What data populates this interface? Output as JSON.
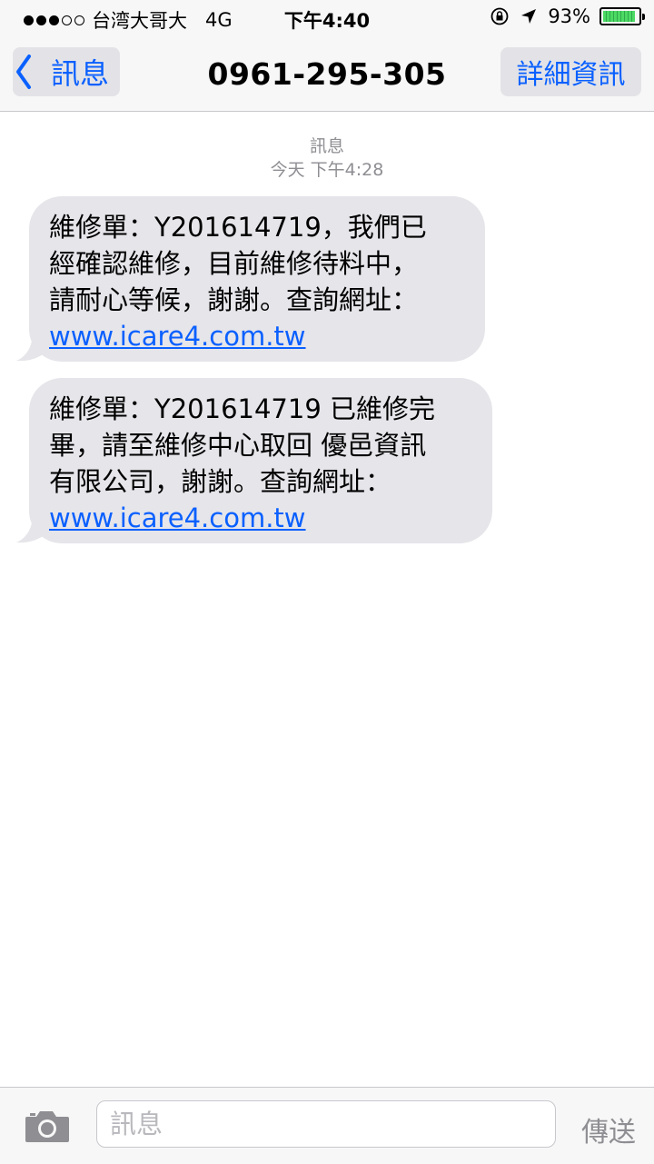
{
  "status_bar": {
    "carrier": "台湾大哥大",
    "network": "4G",
    "time": "下午4:40",
    "battery_percent_label": "93%",
    "battery_level": 0.93,
    "signal_bars_filled": 3,
    "signal_bars_total": 5
  },
  "nav": {
    "back_label": "訊息",
    "title": "0961-295-305",
    "details_label": "詳細資訊"
  },
  "conversation": {
    "service_label": "訊息",
    "timestamp": "今天 下午4:28"
  },
  "messages": [
    {
      "lines": [
        "維修單：Y201614719，我們已",
        "經確認維修，目前維修待料中，",
        "請耐心等候，謝謝。查詢網址："
      ],
      "link": "www.icare4.com.tw"
    },
    {
      "lines": [
        "維修單：Y201614719 已維修完",
        "畢，請至維修中心取回 優邑資訊",
        "有限公司，謝謝。查詢網址："
      ],
      "link": "www.icare4.com.tw"
    }
  ],
  "input_bar": {
    "placeholder": "訊息",
    "send_label": "傳送"
  },
  "colors": {
    "accent": "#0a60ff",
    "bubble_bg": "#e5e5ea",
    "bar_bg": "#f7f7f7",
    "muted_text": "#8e8e93"
  },
  "icons": {
    "lock": "rotation-lock-icon",
    "location": "location-arrow-icon",
    "camera": "camera-icon",
    "back": "chevron-left-icon"
  }
}
